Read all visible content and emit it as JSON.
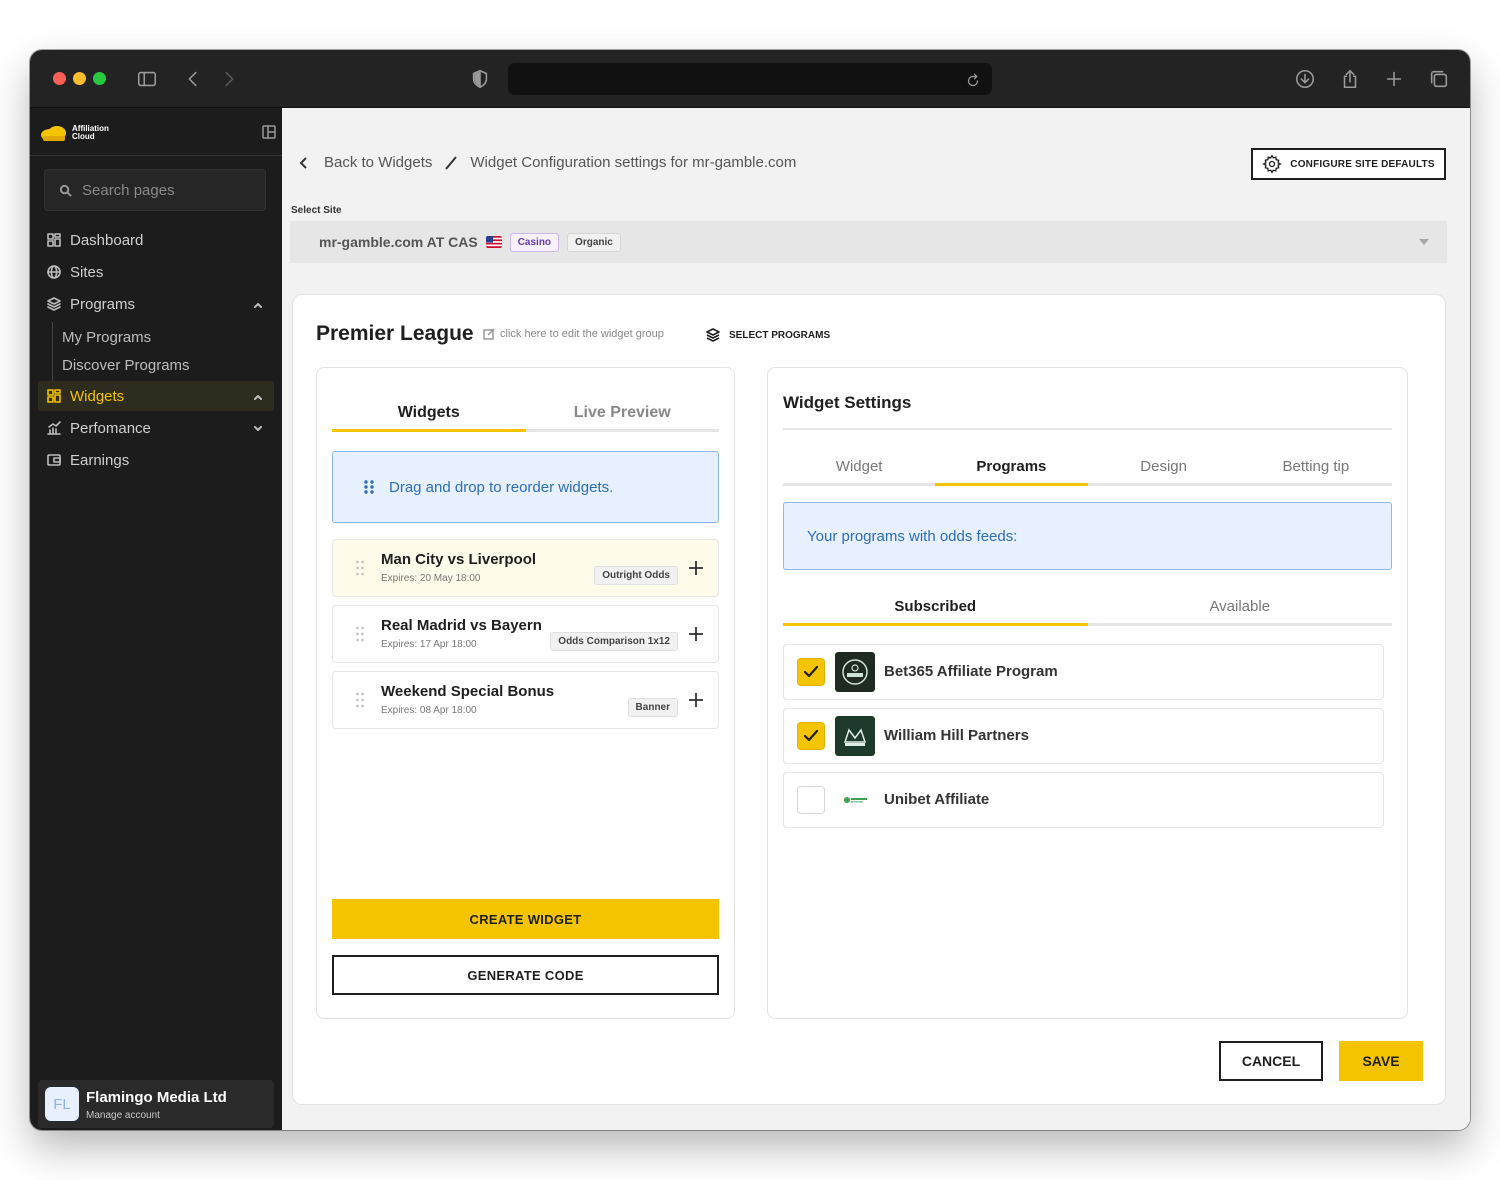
{
  "browser": {
    "url": ""
  },
  "brand": {
    "line1": "Affiliation",
    "line2": "Cloud",
    "accent_color": "#f5c400"
  },
  "sidebar": {
    "search_placeholder": "Search pages",
    "items": [
      {
        "label": "Dashboard",
        "icon": "dashboard-icon"
      },
      {
        "label": "Sites",
        "icon": "globe-icon"
      },
      {
        "label": "Programs",
        "icon": "layers-icon"
      },
      {
        "label": "Widgets",
        "icon": "widgets-icon",
        "active": true
      },
      {
        "label": "Perfomance",
        "icon": "chart-icon"
      },
      {
        "label": "Earnings",
        "icon": "wallet-icon"
      }
    ],
    "programs_sub": [
      "My Programs",
      "Discover Programs"
    ],
    "account": {
      "initials": "FL",
      "name": "Flamingo Media Ltd",
      "manage": "Manage account"
    }
  },
  "header": {
    "back_label": "Back to Widgets",
    "crumb_current": "Widget Configuration settings for mr-gamble.com",
    "config_button": "CONFIGURE SITE DEFAULTS"
  },
  "site_select": {
    "label": "Select Site",
    "value": "mr-gamble.com AT CAS",
    "tags": [
      "Casino",
      "Organic"
    ]
  },
  "group": {
    "title": "Premier League",
    "edit_hint": "click here to edit the widget group",
    "select_programs": "SELECT PROGRAMS"
  },
  "left_panel": {
    "tabs": [
      "Widgets",
      "Live Preview"
    ],
    "info": "Drag and drop to reorder widgets.",
    "widgets": [
      {
        "title": "Man City vs Liverpool",
        "expires": "Expires: 20 May 18:00",
        "tag": "Outright Odds"
      },
      {
        "title": "Real Madrid vs Bayern",
        "expires": "Expires: 17 Apr 18:00",
        "tag": "Odds Comparison 1x12"
      },
      {
        "title": "Weekend Special Bonus",
        "expires": "Expires: 08 Apr 18:00",
        "tag": "Banner"
      }
    ],
    "create_button": "CREATE WIDGET",
    "generate_button": "GENERATE CODE"
  },
  "right_panel": {
    "title": "Widget Settings",
    "tabs": [
      "Widget",
      "Programs",
      "Design",
      "Betting tip"
    ],
    "info": "Your programs with odds feeds:",
    "sub_tabs": [
      "Subscribed",
      "Available"
    ],
    "programs": [
      {
        "name": "Bet365 Affiliate Program",
        "checked": true
      },
      {
        "name": "William Hill Partners",
        "checked": true
      },
      {
        "name": "Unibet Affiliate",
        "checked": false
      }
    ]
  },
  "footer": {
    "cancel": "CANCEL",
    "save": "SAVE"
  }
}
